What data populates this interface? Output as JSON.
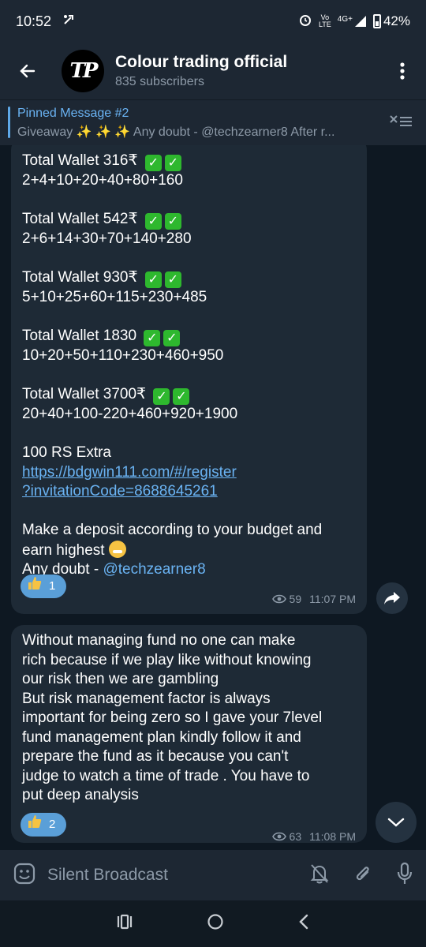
{
  "status_bar": {
    "time": "10:52",
    "network_top": "Vo",
    "network_bottom": "LTE",
    "signal_label": "4G+",
    "battery": "42%"
  },
  "header": {
    "avatar_text": "TP",
    "title": "Colour trading official",
    "subscribers": "835 subscribers"
  },
  "pinned": {
    "title": "Pinned Message #2",
    "body": "Giveaway ✨ ✨ ✨  Any doubt - @techzearner8 After r..."
  },
  "message1": {
    "blocks": [
      {
        "wallet": "Total Wallet 316₹",
        "seq": "2+4+10+20+40+80+160"
      },
      {
        "wallet": "Total Wallet 542₹",
        "seq": "2+6+14+30+70+140+280"
      },
      {
        "wallet": "Total Wallet 930₹",
        "seq": "5+10+25+60+115+230+485"
      },
      {
        "wallet": "Total Wallet 1830",
        "seq": "10+20+50+110+230+460+950"
      },
      {
        "wallet": "Total Wallet 3700₹",
        "seq": "20+40+100-220+460+920+1900"
      }
    ],
    "check": "✓",
    "extra": "100 RS Extra",
    "link_line1": "https://bdgwin111.com/#/register",
    "link_line2": "?invitationCode=8688645261",
    "deposit_line1": "Make a deposit according to your budget and",
    "deposit_line2": "earn highest",
    "doubt_prefix": "Any doubt - ",
    "doubt_mention": "@techzearner8",
    "reaction_count": "1",
    "views": "59",
    "time": "11:07 PM"
  },
  "message2": {
    "lines": [
      "Without managing fund no one can make",
      "rich because if we play like without knowing",
      "our risk then we are gambling",
      "But risk management factor is always",
      "important for being zero so I gave your 7level",
      "fund management plan kindly follow it and",
      "prepare the fund as it because you can't",
      "judge to watch a time of trade . You have to",
      "put deep analysis"
    ],
    "reaction_count": "2",
    "views": "63",
    "time": "11:08 PM"
  },
  "input": {
    "label": "Silent Broadcast"
  }
}
